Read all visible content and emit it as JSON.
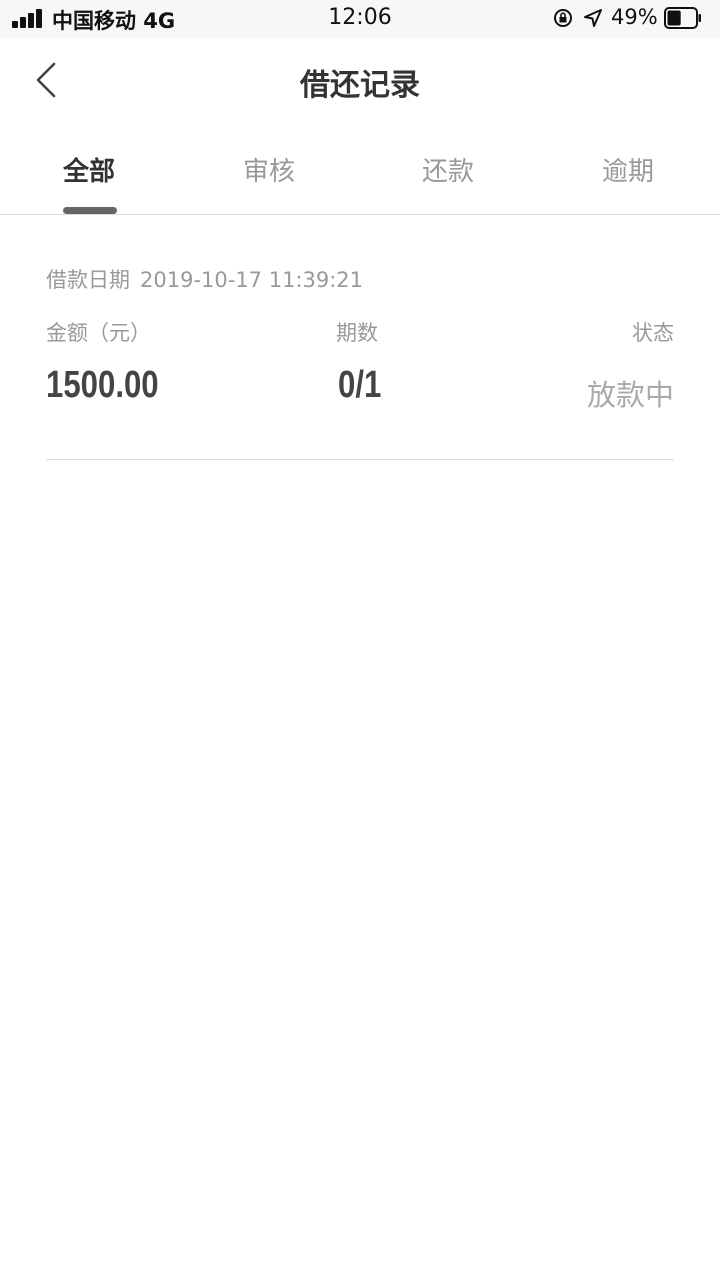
{
  "status_bar": {
    "carrier": "中国移动 4G",
    "time": "12:06",
    "battery_percent": "49%",
    "battery_level": 0.49
  },
  "nav": {
    "title": "借还记录"
  },
  "tabs": [
    {
      "label": "全部",
      "active": true
    },
    {
      "label": "审核",
      "active": false
    },
    {
      "label": "还款",
      "active": false
    },
    {
      "label": "逾期",
      "active": false
    }
  ],
  "records": [
    {
      "date_label": "借款日期",
      "date_value": "2019-10-17 11:39:21",
      "amount_label": "金额（元）",
      "amount_value": "1500.00",
      "period_label": "期数",
      "period_value": "0/1",
      "status_label": "状态",
      "status_value": "放款中"
    }
  ],
  "colors": {
    "text_primary": "#333333",
    "text_secondary": "#999999",
    "indicator": "#666666",
    "divider": "#dcdcdc"
  }
}
